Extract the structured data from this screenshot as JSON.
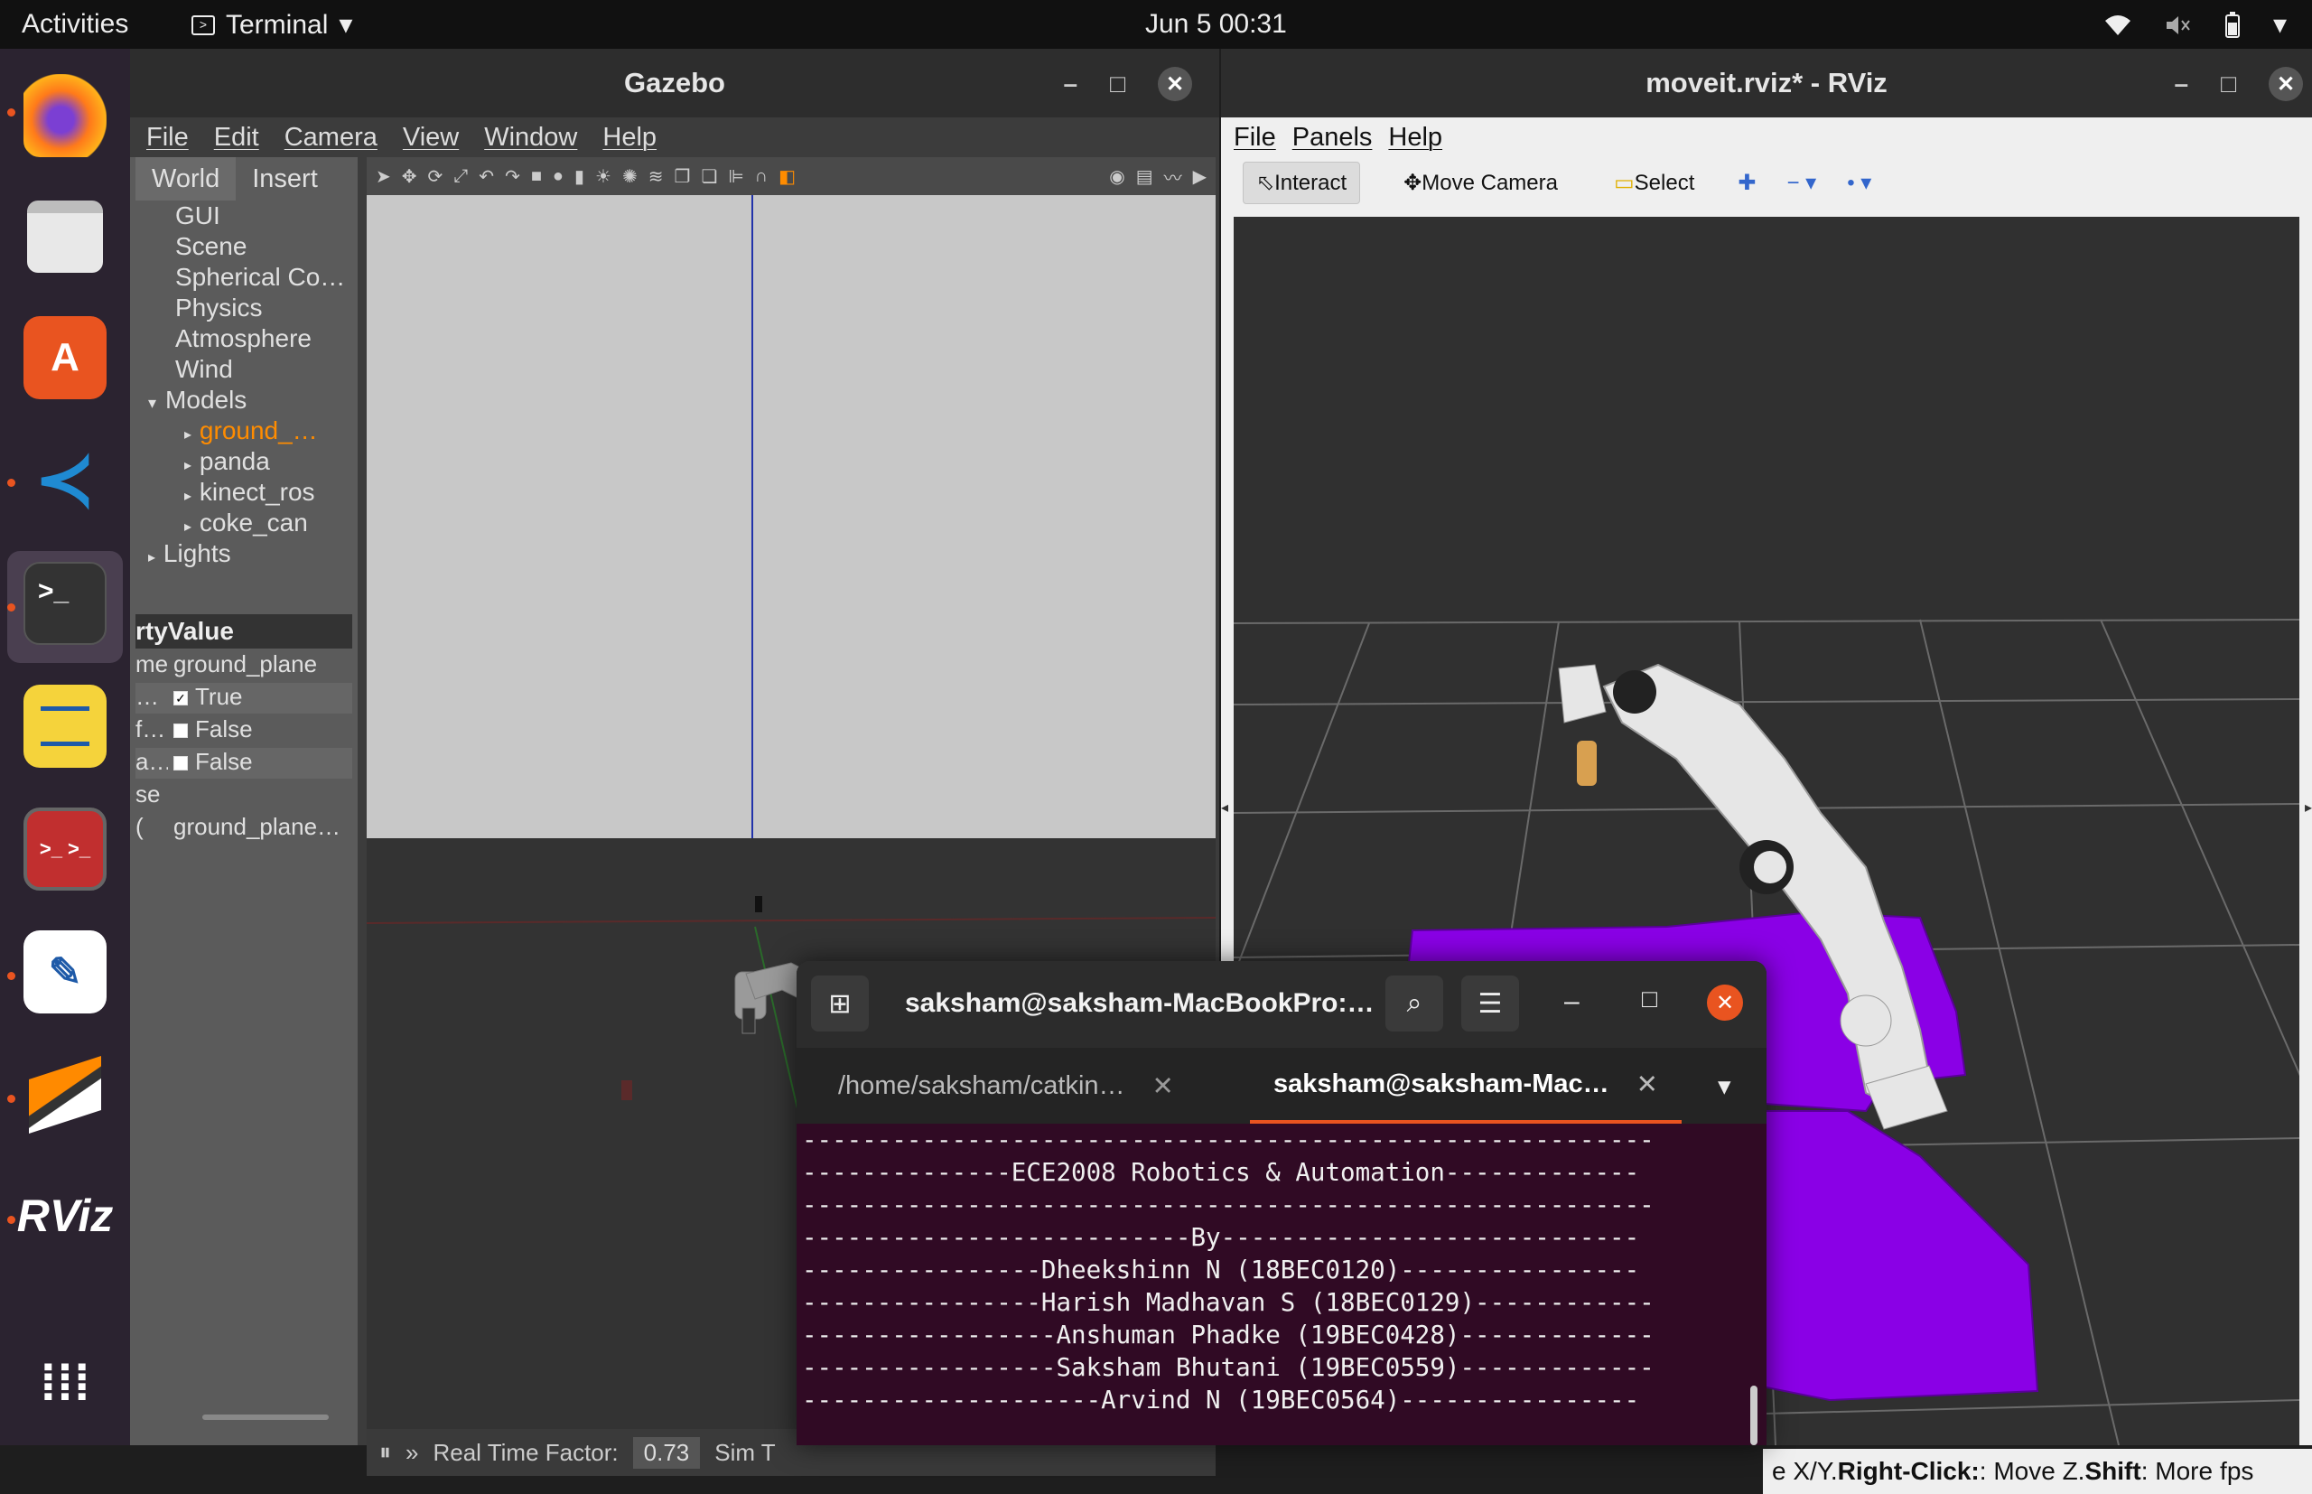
{
  "topbar": {
    "activities": "Activities",
    "app_name": "Terminal",
    "clock": "Jun 5  00:31"
  },
  "dock": {
    "items": [
      "firefox",
      "files",
      "software",
      "vscode",
      "terminal",
      "notes",
      "remote",
      "editor",
      "sublime",
      "RViz",
      "apps"
    ],
    "rviz_label": "RViz"
  },
  "gazebo": {
    "title": "Gazebo",
    "menu": [
      "File",
      "Edit",
      "Camera",
      "View",
      "Window",
      "Help"
    ],
    "tabs": [
      "World",
      "Insert"
    ],
    "tree": [
      "GUI",
      "Scene",
      "Spherical Co…",
      "Physics",
      "Atmosphere",
      "Wind",
      "Models",
      "ground_…",
      "panda",
      "kinect_ros",
      "coke_can",
      "Lights"
    ],
    "prop_header": "rtyValue",
    "props": [
      {
        "k": "me",
        "v": "ground_plane"
      },
      {
        "k": "…",
        "v": "True"
      },
      {
        "k": "f…",
        "v": "False"
      },
      {
        "k": "a…",
        "v": "False"
      },
      {
        "k": "se",
        "v": ""
      },
      {
        "k": "(",
        "v": "ground_plane…"
      }
    ],
    "status": {
      "label": "Real Time Factor:",
      "value": "0.73",
      "sim": "Sim T"
    }
  },
  "rviz": {
    "title": "moveit.rviz* - RViz",
    "menu": [
      "File",
      "Panels",
      "Help"
    ],
    "tools": [
      "Interact",
      "Move Camera",
      "Select"
    ],
    "status": {
      "p1": "e X/Y. ",
      "b1": "Right-Click:",
      "p2": ": Move Z. ",
      "b2": "Shift",
      "p3": ": More ",
      "fps": "fps"
    }
  },
  "terminal": {
    "title": "saksham@saksham-MacBookPro:…",
    "tabs": [
      "/home/saksham/catkin…",
      "saksham@saksham-Mac…"
    ],
    "lines": [
      "---------------------------------------------------------",
      "--------------ECE2008 Robotics & Automation-------------",
      "---------------------------------------------------------",
      "--------------------------By----------------------------",
      "----------------Dheekshinn N (18BEC0120)----------------",
      "----------------Harish Madhavan S (18BEC0129)------------",
      "-----------------Anshuman Phadke (19BEC0428)-------------",
      "-----------------Saksham Bhutani (19BEC0559)-------------",
      "--------------------Arvind N (19BEC0564)----------------"
    ]
  },
  "colors": {
    "accent": "#e95420",
    "terminal_bg": "#300a24",
    "octomap": "#8a00e6",
    "gazebo_sky": "#c8c8c8"
  }
}
